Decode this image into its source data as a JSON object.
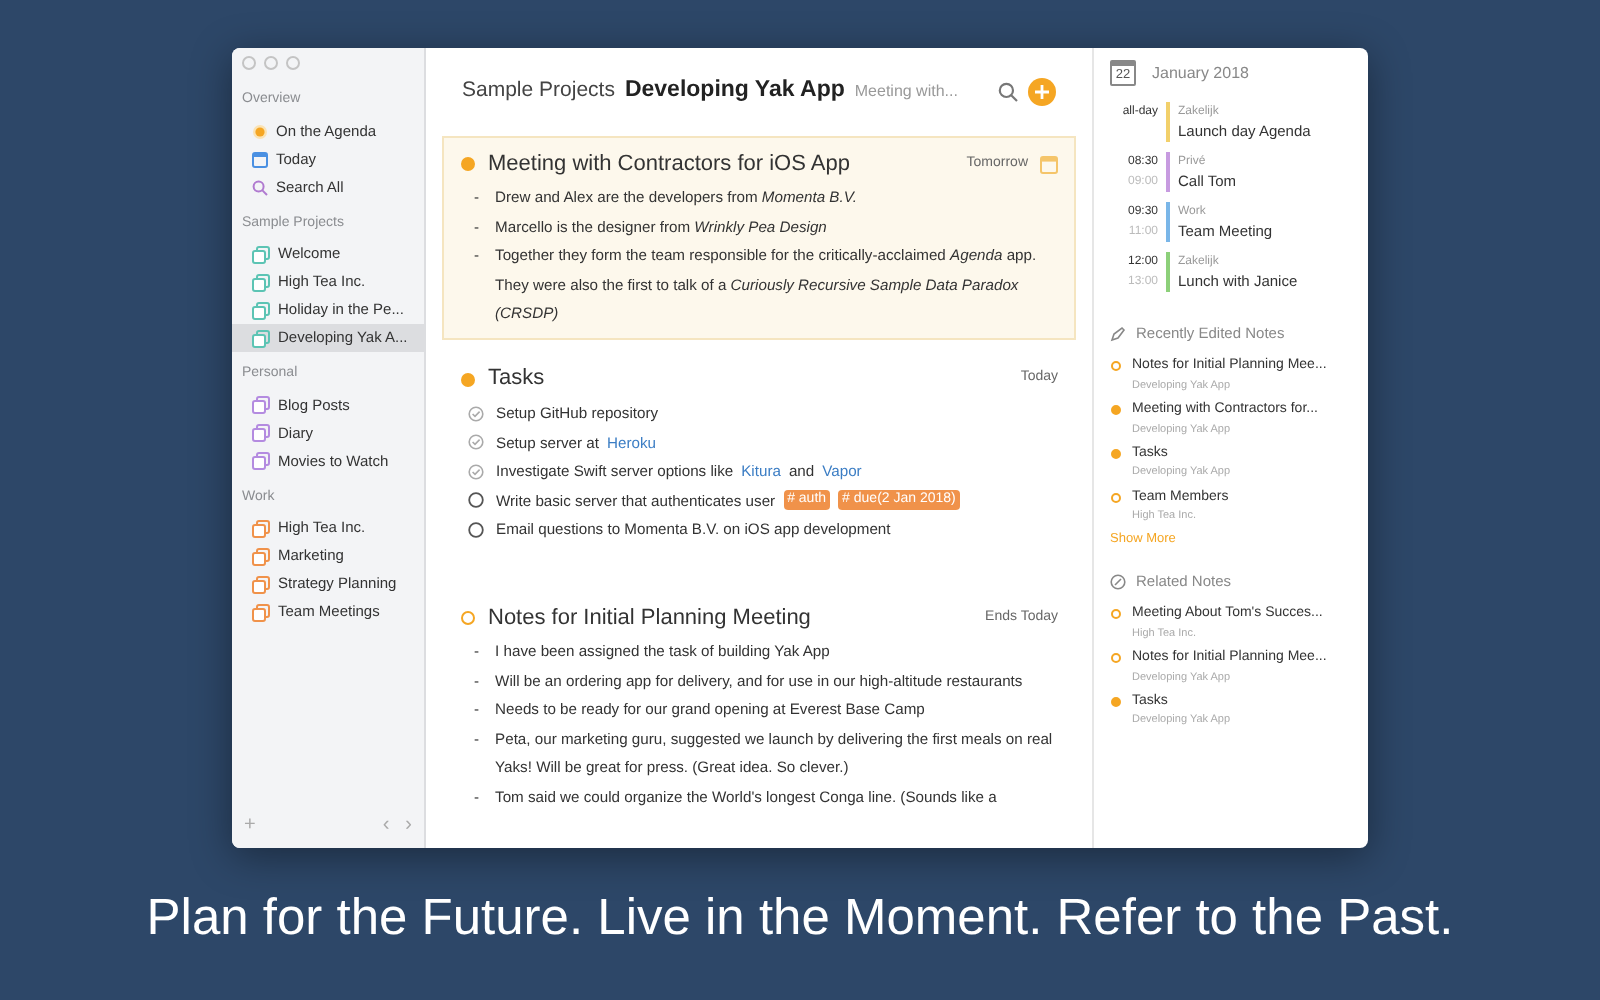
{
  "sidebar": {
    "sections": [
      {
        "title": "Overview",
        "items": [
          {
            "label": "On the Agenda",
            "kind": "agenda",
            "selected": false
          },
          {
            "label": "Today",
            "kind": "today",
            "selected": false
          },
          {
            "label": "Search All",
            "kind": "search",
            "selected": false
          }
        ]
      },
      {
        "title": "Sample Projects",
        "items": [
          {
            "label": "Welcome",
            "kind": "project",
            "color": "#5cc4b4",
            "selected": false
          },
          {
            "label": "High Tea Inc.",
            "kind": "project",
            "color": "#5cc4b4",
            "selected": false
          },
          {
            "label": "Holiday in the Pe...",
            "kind": "project",
            "color": "#5cc4b4",
            "selected": false
          },
          {
            "label": "Developing Yak A...",
            "kind": "project",
            "color": "#5cc4b4",
            "selected": true
          }
        ]
      },
      {
        "title": "Personal",
        "items": [
          {
            "label": "Blog Posts",
            "kind": "project",
            "color": "#b48be0",
            "selected": false
          },
          {
            "label": "Diary",
            "kind": "project",
            "color": "#b48be0",
            "selected": false
          },
          {
            "label": "Movies to Watch",
            "kind": "project",
            "color": "#b48be0",
            "selected": false
          }
        ]
      },
      {
        "title": "Work",
        "items": [
          {
            "label": "High Tea Inc.",
            "kind": "project",
            "color": "#f0924a",
            "selected": false
          },
          {
            "label": "Marketing",
            "kind": "project",
            "color": "#f0924a",
            "selected": false
          },
          {
            "label": "Strategy Planning",
            "kind": "project",
            "color": "#f0924a",
            "selected": false
          },
          {
            "label": "Team Meetings",
            "kind": "project",
            "color": "#f0924a",
            "selected": false
          }
        ]
      }
    ]
  },
  "sidebar_footer": {
    "add": "+",
    "back": "‹",
    "forward": "›"
  },
  "header": {
    "breadcrumb": "Sample Projects",
    "project": "Developing Yak App",
    "note": "Meeting with..."
  },
  "notes": [
    {
      "title": "Meeting with Contractors for iOS App",
      "date": "Tomorrow",
      "filled": true,
      "selected": true,
      "kind": "bullets",
      "marker": "-",
      "bullets": [
        "Drew and Alex are the developers from *Momenta B.V.*",
        "Marcello is the designer from *Wrinkly Pea Design*",
        "Together they form the team responsible for the critically-acclaimed *Agenda* app. They were also the first to talk of a *Curiously Recursive Sample Data Paradox (CRSDP)*"
      ]
    },
    {
      "title": "Tasks",
      "date": "Today",
      "filled": true,
      "selected": false,
      "kind": "tasks",
      "tasks": [
        {
          "done": true,
          "parts": [
            {
              "text": "Setup GitHub repository",
              "kind": "plain"
            }
          ]
        },
        {
          "done": true,
          "parts": [
            {
              "text": "Setup server at",
              "kind": "plain"
            },
            {
              "text": "Heroku",
              "kind": "link"
            }
          ]
        },
        {
          "done": true,
          "parts": [
            {
              "text": "Investigate Swift server options like",
              "kind": "plain"
            },
            {
              "text": "Kitura",
              "kind": "link"
            },
            {
              "text": "and",
              "kind": "plain"
            },
            {
              "text": "Vapor",
              "kind": "link"
            }
          ]
        },
        {
          "done": false,
          "parts": [
            {
              "text": "Write basic server that authenticates user",
              "kind": "plain"
            }
          ],
          "tags": [
            "# auth",
            "# due(2 Jan 2018)"
          ]
        },
        {
          "done": false,
          "parts": [
            {
              "text": "Email questions to Momenta B.V. on iOS app development",
              "kind": "plain"
            }
          ]
        }
      ]
    },
    {
      "title": "Notes for Initial Planning Meeting",
      "date": "Ends Today",
      "filled": false,
      "selected": false,
      "kind": "bullets",
      "marker": "-",
      "bullets": [
        "I have been assigned the task of building Yak App",
        "Will be an ordering app for delivery, and for use in our high-altitude restaurants",
        "Needs to be ready for our grand opening at Everest Base Camp",
        "Peta, our marketing guru, suggested we launch by delivering the first meals on real Yaks! Will be great for press. (Great idea. So clever.)",
        "Tom said we could organize the World's longest Conga line. (Sounds like a"
      ]
    }
  ],
  "calendar": {
    "day": "22",
    "month": "January 2018",
    "events": [
      {
        "start": "all-day",
        "category": "Zakelijk",
        "title": "Launch day Agenda",
        "color": "#f2d06b"
      },
      {
        "start": "08:30",
        "end": "09:00",
        "category": "Privé",
        "title": "Call Tom",
        "color": "#c79be0"
      },
      {
        "start": "09:30",
        "end": "11:00",
        "category": "Work",
        "title": "Team Meeting",
        "color": "#7ab6e8"
      },
      {
        "start": "12:00",
        "end": "13:00",
        "category": "Zakelijk",
        "title": "Lunch with Janice",
        "color": "#8dd07a"
      }
    ]
  },
  "recent": {
    "title": "Recently Edited Notes",
    "items": [
      {
        "title": "Notes for Initial Planning Mee...",
        "project": "Developing Yak App",
        "filled": false
      },
      {
        "title": "Meeting with Contractors for...",
        "project": "Developing Yak App",
        "filled": true
      },
      {
        "title": "Tasks",
        "project": "Developing Yak App",
        "filled": true
      },
      {
        "title": "Team Members",
        "project": "High Tea Inc.",
        "filled": false
      }
    ],
    "more": "Show More"
  },
  "related": {
    "title": "Related Notes",
    "items": [
      {
        "title": "Meeting About Tom's Succes...",
        "project": "High Tea Inc.",
        "filled": false
      },
      {
        "title": "Notes for Initial Planning Mee...",
        "project": "Developing Yak App",
        "filled": false
      },
      {
        "title": "Tasks",
        "project": "Developing Yak App",
        "filled": true
      }
    ]
  },
  "caption": "Plan for the Future. Live in the Moment. Refer to the Past."
}
